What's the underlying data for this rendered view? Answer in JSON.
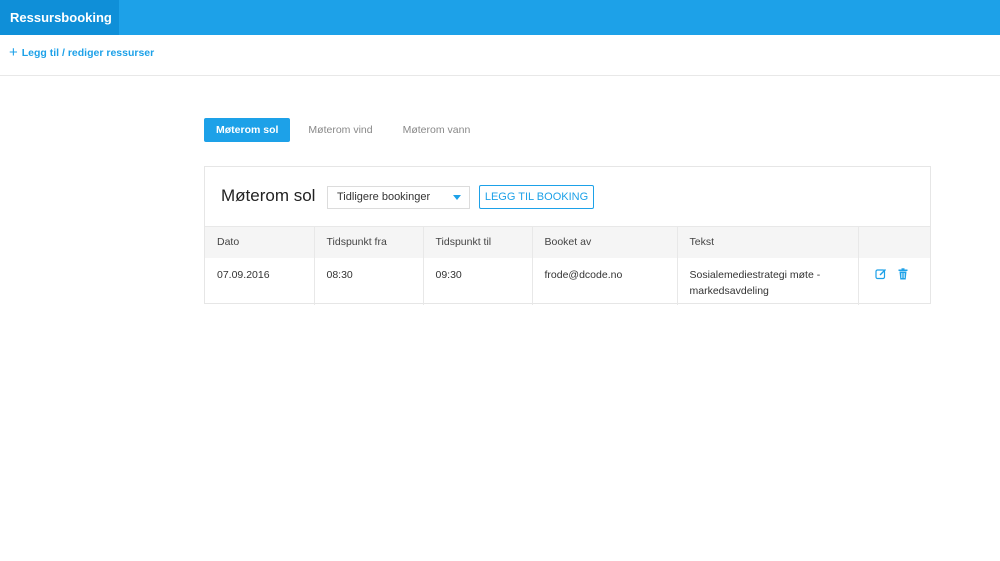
{
  "app": {
    "title": "Ressursbooking"
  },
  "subbar": {
    "add_link": "Legg til / rediger ressurser"
  },
  "tabs": [
    {
      "label": "Møterom sol",
      "active": true
    },
    {
      "label": "Møterom vind",
      "active": false
    },
    {
      "label": "Møterom vann",
      "active": false
    }
  ],
  "panel": {
    "title": "Møterom sol",
    "filter_selected": "Tidligere bookinger",
    "add_button": "LEGG TIL BOOKING"
  },
  "table": {
    "columns": [
      "Dato",
      "Tidspunkt fra",
      "Tidspunkt til",
      "Booket av",
      "Tekst",
      ""
    ],
    "rows": [
      {
        "date": "07.09.2016",
        "from": "08:30",
        "to": "09:30",
        "booked_by": "frode@dcode.no",
        "text": "Sosialemediestrategi møte - markedsavdeling"
      }
    ]
  },
  "colors": {
    "accent": "#1da1e8",
    "brand_dark": "#0f8fd8"
  },
  "icons": {
    "add": "plus-icon",
    "dropdown": "caret-down-icon",
    "edit": "edit-icon",
    "delete": "trash-icon"
  }
}
